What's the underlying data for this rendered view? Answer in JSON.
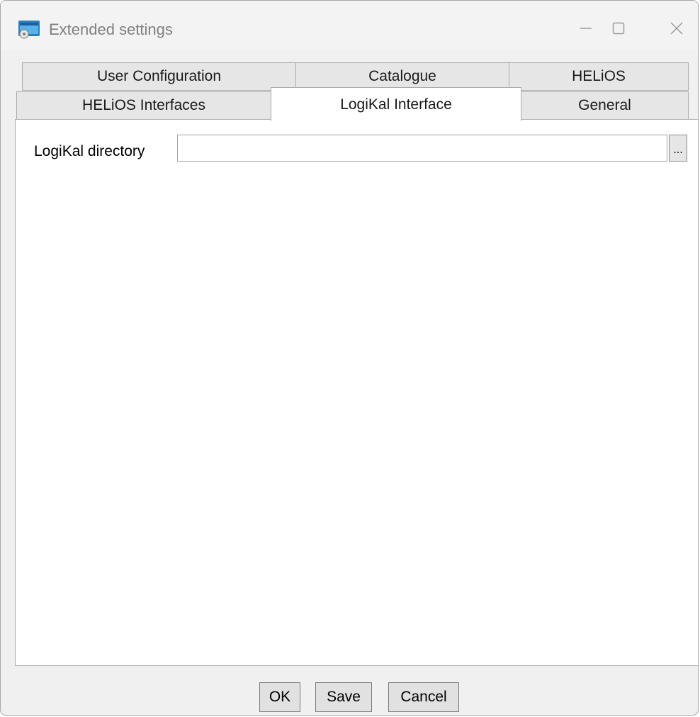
{
  "window": {
    "title": "Extended settings",
    "app_icon": "app-window-icon"
  },
  "title_controls": {
    "minimize": "minimize-icon",
    "maximize": "maximize-icon",
    "close": "close-icon"
  },
  "tabs": {
    "row1": [
      {
        "label": "User Configuration"
      },
      {
        "label": "Catalogue"
      },
      {
        "label": "HELiOS"
      }
    ],
    "row2": [
      {
        "label": "HELiOS Interfaces"
      },
      {
        "label": "LogiKal Interface",
        "active": true
      },
      {
        "label": "General"
      }
    ]
  },
  "logikal": {
    "directory_label": "LogiKal directory",
    "directory_value": "",
    "browse_label": "..."
  },
  "footer": {
    "ok_label": "OK",
    "save_label": "Save",
    "cancel_label": "Cancel"
  }
}
